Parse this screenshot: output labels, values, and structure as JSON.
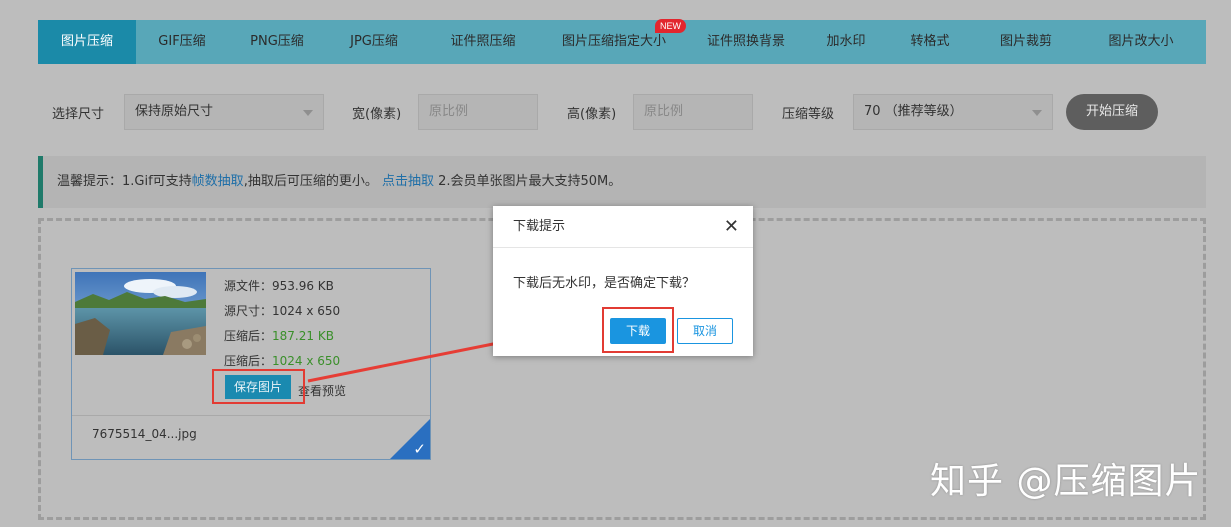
{
  "tabs": [
    {
      "label": "图片压缩",
      "active": true
    },
    {
      "label": "GIF压缩"
    },
    {
      "label": "PNG压缩"
    },
    {
      "label": "JPG压缩"
    },
    {
      "label": "证件照压缩"
    },
    {
      "label": "图片压缩指定大小",
      "badge": "NEW"
    },
    {
      "label": "证件照换背景"
    },
    {
      "label": "加水印"
    },
    {
      "label": "转格式"
    },
    {
      "label": "图片裁剪"
    },
    {
      "label": "图片改大小"
    }
  ],
  "options": {
    "size_label": "选择尺寸",
    "size_value": "保持原始尺寸",
    "width_label": "宽(像素)",
    "width_placeholder": "原比例",
    "height_label": "高(像素)",
    "height_placeholder": "原比例",
    "level_label": "压缩等级",
    "level_value": "70 （推荐等级）",
    "start_button": "开始压缩"
  },
  "tip": {
    "prefix": "温馨提示：1.Gif可支持",
    "link1": "帧数抽取",
    "middle": ",抽取后可压缩的更小。 ",
    "link2": "点击抽取",
    "suffix": " 2.会员单张图片最大支持50M。"
  },
  "file_card": {
    "source_file": "源文件：953.96 KB",
    "source_size": "源尺寸：1024 x 650",
    "compressed_label": "压缩后：",
    "compressed_file": "187.21 KB",
    "compressed_size_label": "压缩后：",
    "compressed_size": "1024 x 650",
    "save_button": "保存图片",
    "preview_link": "查看预览",
    "file_name": "7675514_04...jpg",
    "check": "✓"
  },
  "modal": {
    "title": "下载提示",
    "close": "✕",
    "message": "下载后无水印，是否确定下载？",
    "ok_button": "下载",
    "cancel_button": "取消"
  },
  "watermark": "知乎 @压缩图片",
  "colors": {
    "accent": "#1a95e0",
    "tab_active": "#1b8aa8",
    "highlight_red": "#e23b33",
    "success_green": "#3a8f2a"
  }
}
